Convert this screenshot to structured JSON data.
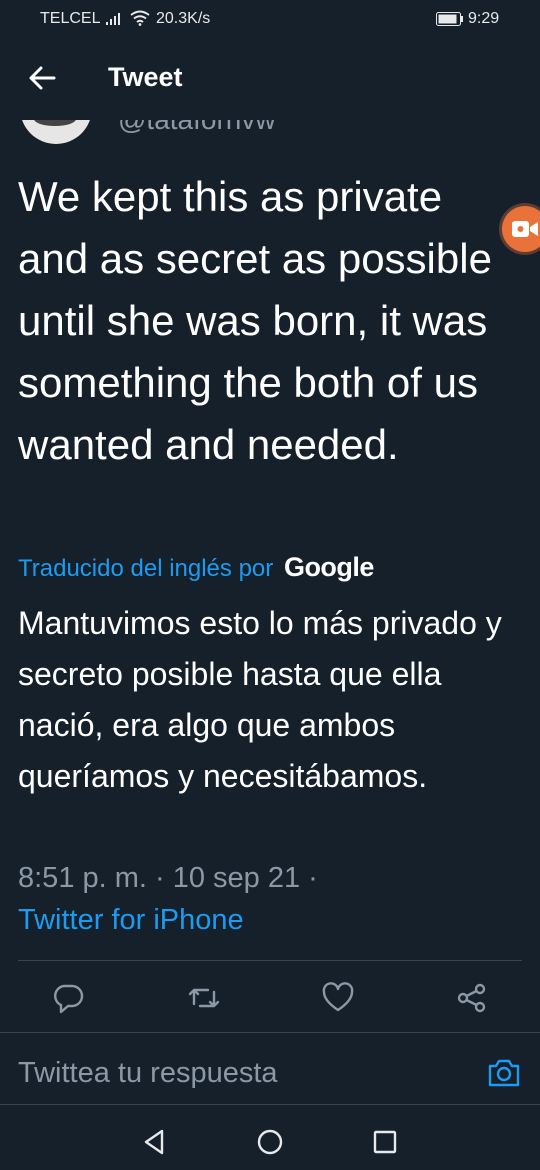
{
  "status_bar": {
    "carrier": "TELCEL",
    "speed": "20.3K/s",
    "time": "9:29",
    "icons": [
      "signal-icon",
      "wifi-icon",
      "battery-icon"
    ]
  },
  "header": {
    "title": "Tweet",
    "back_icon": "arrow-left-icon"
  },
  "tweet": {
    "handle": "@tatafornvw",
    "text": "We kept this as private and as secret as possible until she was born, it was something the both of us wanted and needed.",
    "translated_by": "Traducido del inglés por",
    "translator_brand": "Google",
    "translation": "Mantuvimos esto lo más privado y secreto posible hasta que ella nació, era algo que ambos queríamos y necesitábamos.",
    "timestamp": "8:51 p. m. · 10 sep 21 ·",
    "source": "Twitter for iPhone"
  },
  "actions": [
    "reply-icon",
    "retweet-icon",
    "like-icon",
    "share-icon"
  ],
  "reply": {
    "placeholder": "Twittea tu respuesta",
    "camera_icon": "camera-icon"
  },
  "nav_bar": [
    "back-triangle-icon",
    "home-circle-icon",
    "recents-square-icon"
  ],
  "colors": {
    "background": "#15202b",
    "accent": "#1d9bf0",
    "muted": "#8b98a5",
    "divider": "#38444d",
    "recording_bubble": "#e8723a"
  }
}
